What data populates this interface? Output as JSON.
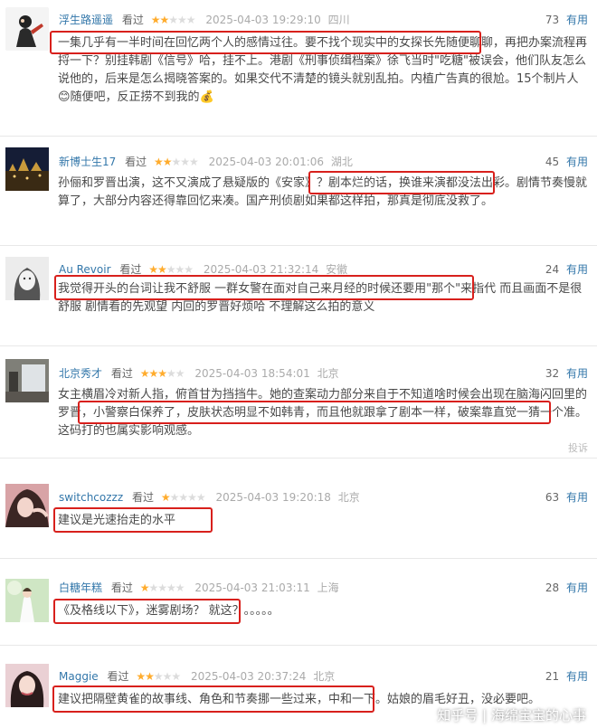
{
  "comments": [
    {
      "username": "浮生路遥遥",
      "watched": "看过",
      "rating": 2,
      "time": "2025-04-03 19:29:10",
      "location": "四川",
      "votes": "73",
      "useful": "有用",
      "text": "一集几乎有一半时间在回忆两个人的感情过往。要不找个现实中的女探长先随便聊聊，再把办案流程再捋一下？别挂韩剧《信号》哈，挂不上。港剧《刑事侦缉档案》徐飞当时\"吃糖\"被误会，他们队友怎么说他的，后来是怎么揭晓答案的。如果交代不清楚的镜头就别乱拍。内植广告真的很尬。15个制片人😊随便吧，反正捞不到我的💰"
    },
    {
      "username": "新博士生17",
      "watched": "看过",
      "rating": 2,
      "time": "2025-04-03 20:01:06",
      "location": "湖北",
      "votes": "45",
      "useful": "有用",
      "text": "孙俪和罗晋出演，这不又演成了悬疑版的《安家》？剧本烂的话，换谁来演都没法出彩。剧情节奏慢就算了，大部分内容还得靠回忆来凑。国产刑侦剧如果都这样拍，那真是彻底没救了。"
    },
    {
      "username": "Au Revoir",
      "watched": "看过",
      "rating": 2,
      "time": "2025-04-03 21:32:14",
      "location": "安徽",
      "votes": "24",
      "useful": "有用",
      "text": "我觉得开头的台词让我不舒服 一群女警在面对自己来月经的时候还要用\"那个\"来指代 而且画面不是很舒服 剧情看的先观望 内回的罗晋好烦哈 不理解这么拍的意义"
    },
    {
      "username": "北京秀才",
      "watched": "看过",
      "rating": 3,
      "time": "2025-04-03 18:54:01",
      "location": "北京",
      "votes": "32",
      "useful": "有用",
      "text": "女主横眉冷对新人指，俯首甘为挡挡牛。她的查案动力部分来自于不知道啥时候会出现在脑海闪回里的罗晋，小警察白保养了，皮肤状态明显不如韩青，而且他就跟拿了剧本一样，破案靠直觉一猜一个准。这码打的也属实影响观感。",
      "report": "投诉"
    },
    {
      "username": "switchcozzz",
      "watched": "看过",
      "rating": 1,
      "time": "2025-04-03 19:20:18",
      "location": "北京",
      "votes": "63",
      "useful": "有用",
      "text": "建议是光速抬走的水平"
    },
    {
      "username": "白糖年糕",
      "watched": "看过",
      "rating": 1,
      "time": "2025-04-03 21:03:11",
      "location": "上海",
      "votes": "28",
      "useful": "有用",
      "text": "《及格线以下》，迷雾剧场？ 就这？。。。。。"
    },
    {
      "username": "Maggie",
      "watched": "看过",
      "rating": 2,
      "time": "2025-04-03 20:37:24",
      "location": "北京",
      "votes": "21",
      "useful": "有用",
      "text": "建议把隔壁黄雀的故事线、角色和节奏挪一些过来，中和一下。姑娘的眉毛好丑，没必要吧。"
    }
  ],
  "watermark": "知乎号 | 海绵宝宝的心事",
  "colors": {
    "highlight": "#d8201c",
    "link": "#3377aa",
    "star": "#ffac2d"
  }
}
